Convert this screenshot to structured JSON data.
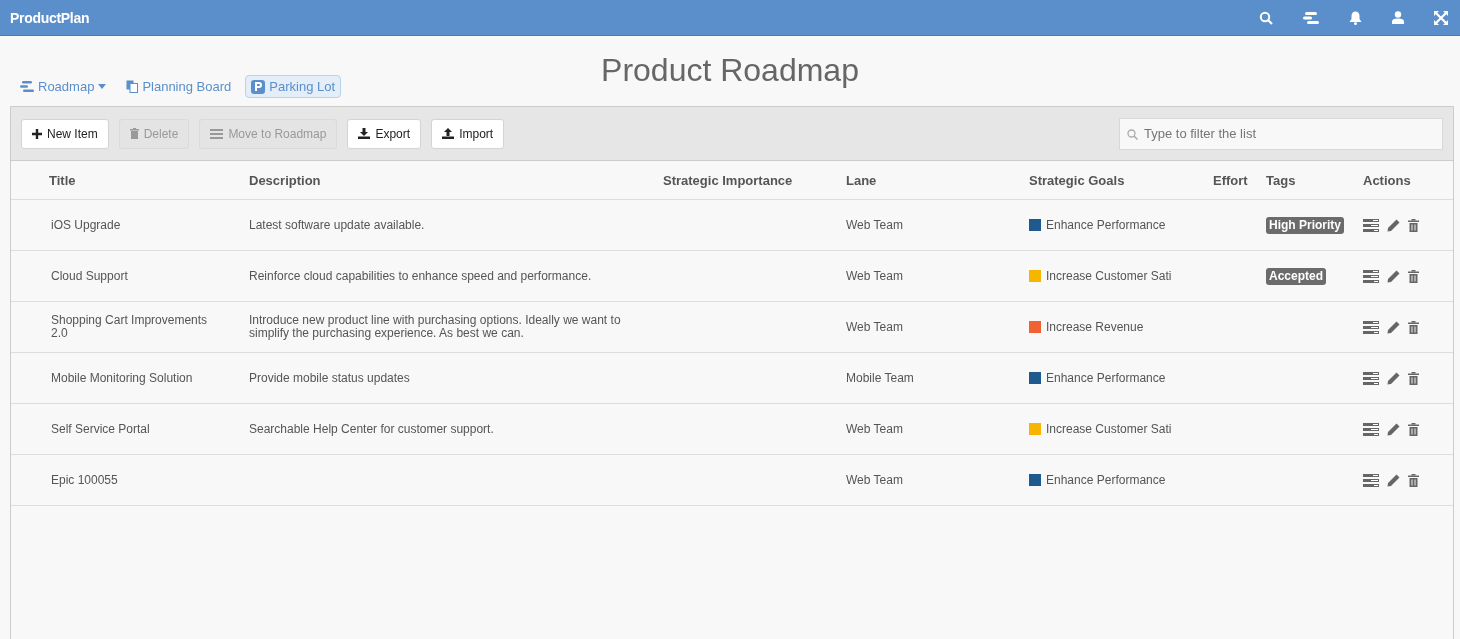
{
  "app": {
    "brand": "ProductPlan"
  },
  "views": [
    {
      "label": "Roadmap",
      "kind": "dropdown",
      "selected": false
    },
    {
      "label": "Planning Board",
      "kind": "board",
      "selected": false
    },
    {
      "label": "Parking Lot",
      "kind": "parking",
      "selected": true
    }
  ],
  "page_title": "Product Roadmap",
  "toolbar": {
    "buttons": [
      {
        "label": "New Item",
        "kind": "plus",
        "disabled": false
      },
      {
        "label": "Delete",
        "kind": "trash",
        "disabled": true
      },
      {
        "label": "Move to Roadmap",
        "kind": "lines",
        "disabled": true
      },
      {
        "label": "Export",
        "kind": "download",
        "disabled": false
      },
      {
        "label": "Import",
        "kind": "upload",
        "disabled": false
      }
    ],
    "search": {
      "placeholder": "Type to filter the list"
    }
  },
  "table": {
    "columns": [
      "Title",
      "Description",
      "Strategic Importance",
      "Lane",
      "Strategic Goals",
      "Effort",
      "Tags",
      "Actions"
    ],
    "rows": [
      {
        "title": "iOS Upgrade",
        "description": "Latest software update available.",
        "lane": "Web Team",
        "goal": "Enhance Performance",
        "color": "#1f5a8e",
        "tag": "High Priority"
      },
      {
        "title": "Cloud Support",
        "description": "Reinforce cloud capabilities to enhance speed and performance.",
        "lane": "Web Team",
        "goal": "Increase Customer Sati",
        "color": "#f7b500",
        "tag": "Accepted"
      },
      {
        "title": "Shopping Cart Improvements 2.0",
        "description": "Introduce new product line with purchasing options. Ideally we want to simplify the purchasing experience. As best we can.",
        "lane": "Web Team",
        "goal": "Increase Revenue",
        "color": "#f26132"
      },
      {
        "title": "Mobile Monitoring Solution",
        "description": "Provide mobile status updates",
        "lane": "Mobile Team",
        "goal": "Enhance Performance",
        "color": "#1f5a8e"
      },
      {
        "title": "Self Service Portal",
        "description": "Searchable Help Center for customer support.",
        "lane": "Web Team",
        "goal": "Increase Customer Sati",
        "color": "#f7b500"
      },
      {
        "title": "Epic 100055",
        "lane": "Web Team",
        "goal": "Enhance Performance",
        "color": "#1f5a8e"
      }
    ]
  }
}
